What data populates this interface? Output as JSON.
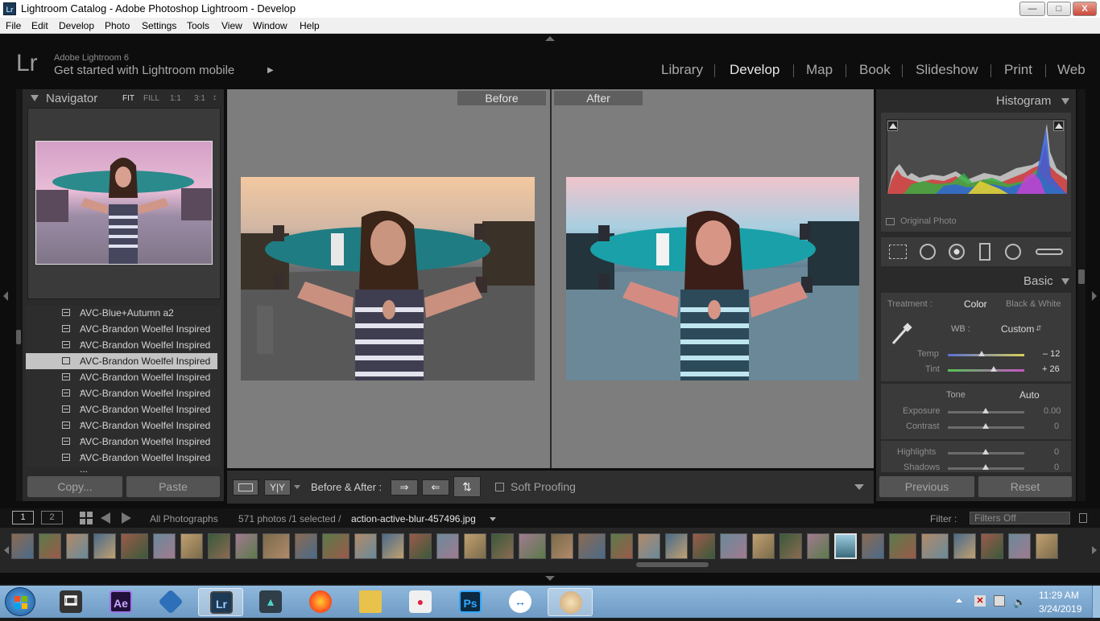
{
  "window": {
    "title": "Lightroom Catalog - Adobe Photoshop Lightroom - Develop",
    "app_badge": "Lr",
    "min": "—",
    "max": "□",
    "close": "X"
  },
  "menu": [
    "File",
    "Edit",
    "Develop",
    "Photo",
    "Settings",
    "Tools",
    "View",
    "Window",
    "Help"
  ],
  "identity": {
    "logo": "Lr",
    "product": "Adobe Lightroom 6",
    "mobile": "Get started with Lightroom mobile",
    "mobile_arrow": "▶"
  },
  "modules": [
    "Library",
    "Develop",
    "Map",
    "Book",
    "Slideshow",
    "Print",
    "Web"
  ],
  "active_module": "Develop",
  "navigator": {
    "title": "Navigator",
    "zoom": [
      "FIT",
      "FILL",
      "1:1",
      "3:1"
    ],
    "zoom_arrow": "↕"
  },
  "presets": [
    "AVC-Blue+Autumn a2",
    "AVC-Brandon Woelfel Inspired ...",
    "AVC-Brandon Woelfel Inspired ...",
    "AVC-Brandon Woelfel Inspired ...",
    "AVC-Brandon Woelfel Inspired ...",
    "AVC-Brandon Woelfel Inspired ...",
    "AVC-Brandon Woelfel Inspired ...",
    "AVC-Brandon Woelfel Inspired ...",
    "AVC-Brandon Woelfel Inspired ...",
    "AVC-Brandon Woelfel Inspired ..."
  ],
  "left_buttons": {
    "copy": "Copy...",
    "paste": "Paste"
  },
  "view": {
    "before": "Before",
    "after": "After"
  },
  "toolbar": {
    "yy": "Y|Y",
    "before_after": "Before & After :",
    "soft_proofing": "Soft Proofing"
  },
  "histogram": {
    "title": "Histogram",
    "original_photo": "Original Photo"
  },
  "basic": {
    "title": "Basic",
    "treatment_label": "Treatment :",
    "color": "Color",
    "bw": "Black & White",
    "wb_label": "WB :",
    "wb_value": "Custom",
    "temp_label": "Temp",
    "temp_value": "– 12",
    "temp_level": 0.44,
    "tint_label": "Tint",
    "tint_value": "+ 26",
    "tint_level": 0.6,
    "tone_label": "Tone",
    "auto": "Auto",
    "exposure_label": "Exposure",
    "exposure_value": "0.00",
    "contrast_label": "Contrast",
    "contrast_value": "0",
    "highlights_label": "Highlights",
    "highlights_value": "0",
    "shadows_label": "Shadows",
    "shadows_value": "0"
  },
  "right_buttons": {
    "previous": "Previous",
    "reset": "Reset"
  },
  "filmstrip_bar": {
    "screen1": "1",
    "screen2": "2",
    "source": "All Photographs",
    "count": "571 photos /1 selected /",
    "filename": "action-active-blur-457496.jpg",
    "filter_label": "Filter :",
    "filter_value": "Filters Off"
  },
  "clock": {
    "time": "11:29 AM",
    "date": "3/24/2019"
  },
  "taskbar_apps": [
    "windows-start",
    "video-editor",
    "after-effects",
    "vector-app",
    "lightroom",
    "filmora",
    "firefox",
    "file-explorer",
    "camera-app",
    "photoshop",
    "teamviewer",
    "paint"
  ],
  "colors": {
    "accent_lr": "#9fd0ff",
    "panel_bg": "#2d2d2d",
    "center_bg": "#7d7d7d",
    "tint_green": "#56c256",
    "tint_magenta": "#c656c6",
    "temp_blue": "#5a6fd8",
    "temp_yellow": "#d8cf56"
  }
}
